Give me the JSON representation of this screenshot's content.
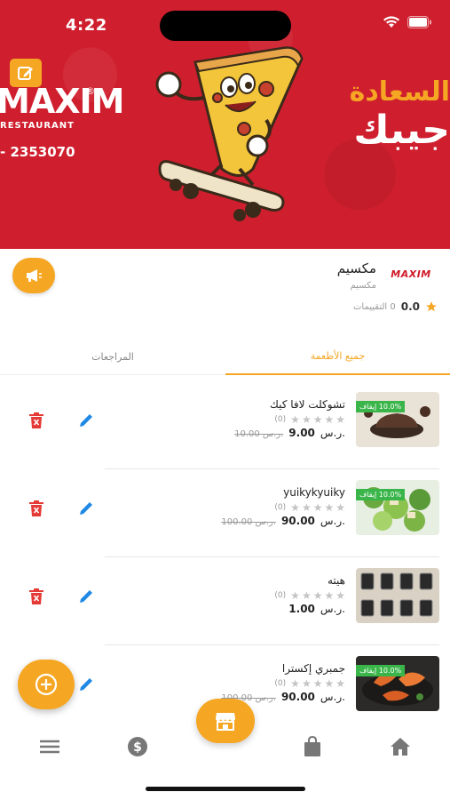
{
  "status_bar": {
    "time": "4:22"
  },
  "banner": {
    "logo_text": "MAXIM",
    "logo_reg": "®",
    "logo_sub": "RESTAURANT",
    "phone": "- 2353070",
    "headline_line1": "السعادة",
    "headline_line2": "جيبك",
    "accent_color": "#f5a623",
    "background_color": "#cf1f2e"
  },
  "restaurant": {
    "logo_text": "MAXIM",
    "name": "مكسيم",
    "subtitle": "مكسيم",
    "rating": "0.0",
    "ratings_count": "0 التقييمات"
  },
  "tabs": [
    {
      "label": "المراجعات",
      "active": false
    },
    {
      "label": "جميع الأطعمة",
      "active": true
    }
  ],
  "foods": [
    {
      "name": "تشوكلت لافا كيك",
      "discount": "10.0% إيقاف",
      "rating_count": "(0)",
      "old_price": "10.00 ر.س.",
      "new_price": "9.00",
      "currency": "ر.س.",
      "image_icon": "lava-cake-image"
    },
    {
      "name": "yuikykyuiky",
      "discount": "10.0% إيقاف",
      "rating_count": "(0)",
      "old_price": "100.00 ر.س.",
      "new_price": "90.00",
      "currency": "ر.س.",
      "image_icon": "salad-image"
    },
    {
      "name": "هيته",
      "discount": "",
      "rating_count": "(0)",
      "old_price": "",
      "new_price": "1.00",
      "currency": "ر.س.",
      "image_icon": "keychains-image"
    },
    {
      "name": "جمبري إكسترا",
      "discount": "10.0% إيقاف",
      "rating_count": "(0)",
      "old_price": "100.00 ر.س.",
      "new_price": "90.00",
      "currency": "ر.س.",
      "image_icon": "shrimp-image"
    }
  ],
  "nav": {
    "items": [
      "menu-icon",
      "dollar-icon",
      "store-icon",
      "bag-icon",
      "home-icon"
    ]
  }
}
